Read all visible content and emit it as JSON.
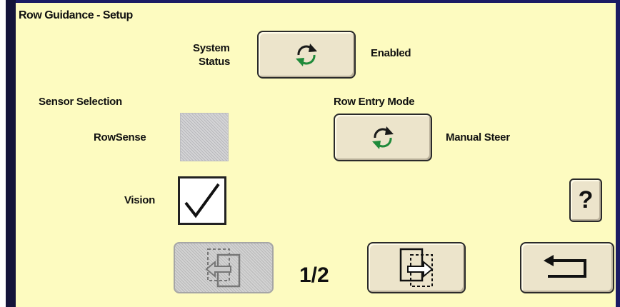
{
  "screen": {
    "title": "Row Guidance - Setup"
  },
  "system_status": {
    "label_line1": "System",
    "label_line2": "Status",
    "value": "Enabled"
  },
  "sensor_selection": {
    "heading": "Sensor Selection",
    "rowsense_label": "RowSense",
    "rowsense_checked": false,
    "vision_label": "Vision",
    "vision_checked": true
  },
  "row_entry_mode": {
    "heading": "Row Entry Mode",
    "value": "Manual Steer"
  },
  "help": {
    "label": "?"
  },
  "pagination": {
    "indicator": "1/2"
  },
  "icons": {
    "cycle": "cycle-arrows-icon",
    "checkmark": "checkmark-icon",
    "prev": "page-previous-icon",
    "next": "page-next-icon",
    "back": "return-arrow-icon"
  },
  "colors": {
    "background": "#fdfbc0",
    "button": "#ece4cb",
    "arrow_green": "#1f8a3a",
    "frame": "#1b1b64"
  }
}
